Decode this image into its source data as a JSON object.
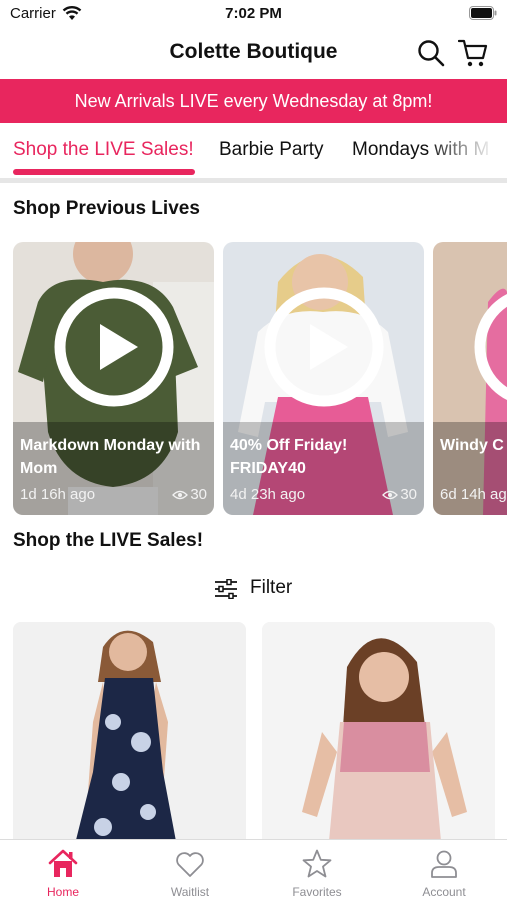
{
  "status_bar": {
    "carrier": "Carrier",
    "time": "7:02 PM"
  },
  "header": {
    "title": "Colette Boutique"
  },
  "banner": {
    "text": "New Arrivals LIVE every Wednesday at 8pm!"
  },
  "tabs": [
    {
      "label": "Shop the LIVE Sales!",
      "active": true
    },
    {
      "label": "Barbie Party",
      "active": false
    },
    {
      "label": "Mondays with M",
      "active": false
    }
  ],
  "previous_lives": {
    "title": "Shop Previous Lives",
    "cards": [
      {
        "title": "Markdown Monday with Mom",
        "ago": "1d 16h ago",
        "views": "30"
      },
      {
        "title": "40% Off Friday! FRIDAY40",
        "ago": "4d 23h ago",
        "views": "30"
      },
      {
        "title": "Windy C Outfits &",
        "ago": "6d 14h ag",
        "views": ""
      }
    ]
  },
  "live_sales": {
    "title": "Shop the LIVE Sales!",
    "filter_label": "Filter"
  },
  "tab_bar": [
    {
      "label": "Home",
      "icon": "home-icon",
      "active": true
    },
    {
      "label": "Waitlist",
      "icon": "heart-icon",
      "active": false
    },
    {
      "label": "Favorites",
      "icon": "star-icon",
      "active": false
    },
    {
      "label": "Account",
      "icon": "person-icon",
      "active": false
    }
  ],
  "colors": {
    "accent": "#e8265e",
    "tab_inactive": "#8e8e93"
  }
}
